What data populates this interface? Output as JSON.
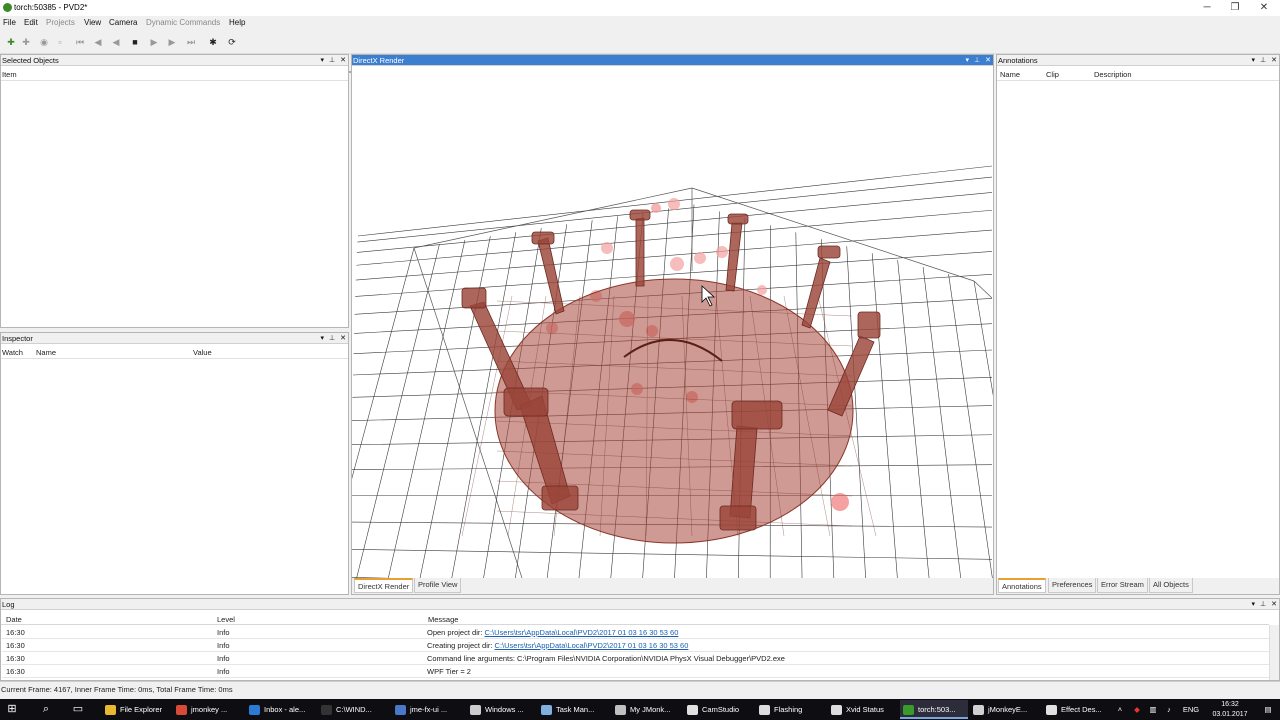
{
  "window": {
    "title": "torch:50385 - PVD2*",
    "min_label": "─",
    "max_label": "❐",
    "close_label": "✕"
  },
  "menu": {
    "items": [
      {
        "label": "File",
        "enabled": true
      },
      {
        "label": "Edit",
        "enabled": true
      },
      {
        "label": "Projects",
        "enabled": false
      },
      {
        "label": "View",
        "enabled": true
      },
      {
        "label": "Camera",
        "enabled": true
      },
      {
        "label": "Dynamic Commands",
        "enabled": false
      },
      {
        "label": "Help",
        "enabled": true
      }
    ]
  },
  "playback": {
    "progress": 0.97
  },
  "panels": {
    "selected_objects": {
      "title": "Selected Objects",
      "col_item": "Item"
    },
    "inspector": {
      "title": "Inspector",
      "col_watch": "Watch",
      "col_name": "Name",
      "col_value": "Value"
    },
    "render": {
      "title": "DirectX Render",
      "tabs": [
        {
          "label": "DirectX Render",
          "active": true
        },
        {
          "label": "Profile View",
          "active": false
        }
      ],
      "accent_color": "#3c7fd0",
      "object_color": "#a8473a"
    },
    "annotations": {
      "title": "Annotations",
      "col_name": "Name",
      "col_clip": "Clip",
      "col_description": "Description",
      "tabs": [
        {
          "label": "Annotations",
          "active": true
        },
        {
          "label": "Preferences",
          "active": false
        },
        {
          "label": "Error Stream",
          "active": false
        },
        {
          "label": "All Objects",
          "active": false
        }
      ]
    },
    "log": {
      "title": "Log",
      "col_date": "Date",
      "col_level": "Level",
      "col_message": "Message",
      "rows": [
        {
          "date": "16:30",
          "level": "Info",
          "prefix": "Open project dir: ",
          "link": "C:\\Users\\tsr\\AppData\\Local\\PVD2\\2017 01 03 16 30 53 60"
        },
        {
          "date": "16:30",
          "level": "Info",
          "prefix": "Creating project dir: ",
          "link": "C:\\Users\\tsr\\AppData\\Local\\PVD2\\2017 01 03 16 30 53 60"
        },
        {
          "date": "16:30",
          "level": "Info",
          "prefix": "Command line arguments: C:\\Program Files\\NVIDIA Corporation\\NVIDIA PhysX Visual Debugger\\PVD2.exe",
          "link": ""
        },
        {
          "date": "16:30",
          "level": "Info",
          "prefix": "WPF Tier = 2",
          "link": ""
        }
      ]
    }
  },
  "status": {
    "text": "Current Frame: 4167, Inner Frame Time: 0ms, Total Frame Time: 0ms"
  },
  "taskbar": {
    "tasks": [
      {
        "label": "File Explorer",
        "icon": "folder-icon",
        "color": "#e8b830",
        "active": false
      },
      {
        "label": "jmonkey ...",
        "icon": "chrome-icon",
        "color": "#d84a38",
        "active": false
      },
      {
        "label": "Inbox - ale...",
        "icon": "mail-icon",
        "color": "#2b7bd4",
        "active": false
      },
      {
        "label": "C:\\WIND...",
        "icon": "console-icon",
        "color": "#333333",
        "active": false
      },
      {
        "label": "jme-fx-ui ...",
        "icon": "shield-icon",
        "color": "#4a78c8",
        "active": false
      },
      {
        "label": "Windows ...",
        "icon": "window-icon",
        "color": "#cccccc",
        "active": false
      },
      {
        "label": "Task Man...",
        "icon": "taskmgr-icon",
        "color": "#7fb0e0",
        "active": false
      },
      {
        "label": "My JMonk...",
        "icon": "jmonkey-icon",
        "color": "#c0c0c0",
        "active": false
      },
      {
        "label": "CamStudio",
        "icon": "camera-icon",
        "color": "#e0e0e0",
        "active": false
      },
      {
        "label": "Flashing",
        "icon": "window-icon",
        "color": "#dddddd",
        "active": false
      },
      {
        "label": "Xvid Status",
        "icon": "video-icon",
        "color": "#dddddd",
        "active": false
      },
      {
        "label": "torch:503...",
        "icon": "pvd-icon",
        "color": "#3a9a2a",
        "active": true
      },
      {
        "label": "jMonkeyE...",
        "icon": "jmonkey-icon",
        "color": "#d0d0d0",
        "active": false
      },
      {
        "label": "Effect Des...",
        "icon": "java-icon",
        "color": "#e0e0e0",
        "active": false
      }
    ],
    "lang": "ENG",
    "time": "16:32",
    "date": "03.01.2017"
  }
}
